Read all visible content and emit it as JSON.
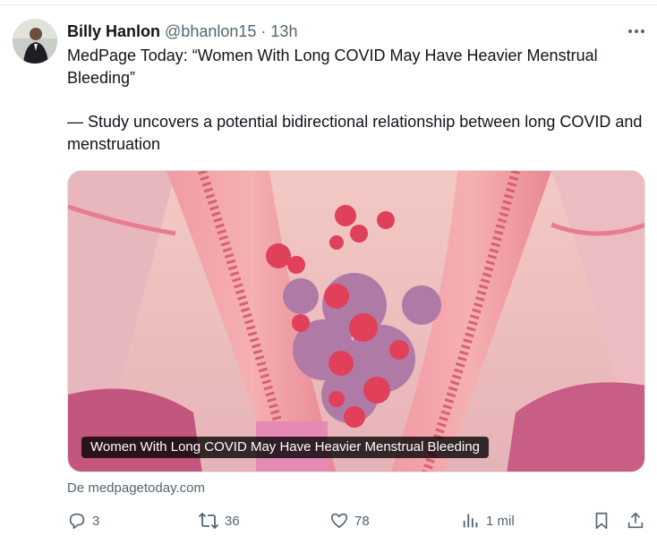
{
  "tweet": {
    "author_name": "Billy Hanlon",
    "author_handle": "@bhanlon15",
    "separator": "·",
    "time": "13h",
    "text_line1": "MedPage Today: “Women With Long COVID May Have Heavier Menstrual Bleeding”",
    "text_line2": "— Study uncovers a potential bidirectional relationship between long COVID and menstruation"
  },
  "card": {
    "caption": "Women With Long COVID May Have Heavier Menstrual Bleeding",
    "source": "De medpagetoday.com"
  },
  "actions": {
    "replies": "3",
    "reposts": "36",
    "likes": "78",
    "views": "1 mil"
  },
  "icons": {
    "more": "more-icon",
    "reply": "reply-icon",
    "repost": "repost-icon",
    "like": "heart-icon",
    "views": "views-icon",
    "bookmark": "bookmark-icon",
    "share": "share-icon"
  },
  "colors": {
    "text": "#0f1419",
    "muted": "#536471",
    "tissue_pink": "#e9808c",
    "clot_red": "#e0405a",
    "clot_purple": "#b07aa6"
  }
}
